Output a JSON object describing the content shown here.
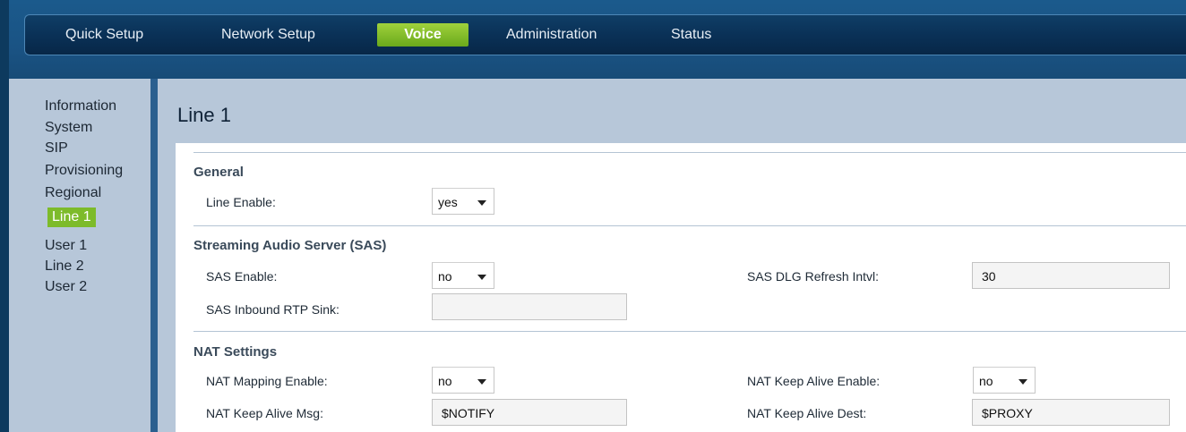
{
  "nav": {
    "items": [
      {
        "label": "Quick Setup"
      },
      {
        "label": "Network Setup"
      },
      {
        "label": "Voice",
        "active": true
      },
      {
        "label": "Administration"
      },
      {
        "label": "Status"
      }
    ],
    "active_color": "#7cb92a"
  },
  "sidebar": {
    "items": [
      {
        "label": "Information"
      },
      {
        "label": "System"
      },
      {
        "label": "SIP"
      },
      {
        "label": "Provisioning"
      },
      {
        "label": "Regional"
      },
      {
        "label": "Line 1",
        "active": true
      },
      {
        "label": "User 1"
      },
      {
        "label": "Line 2"
      },
      {
        "label": "User 2"
      }
    ]
  },
  "page": {
    "title": "Line 1"
  },
  "sections": {
    "general": {
      "title": "General",
      "line_enable_label": "Line Enable:",
      "line_enable_value": "yes"
    },
    "sas": {
      "title": "Streaming Audio Server (SAS)",
      "sas_enable_label": "SAS Enable:",
      "sas_enable_value": "no",
      "sas_dlg_refresh_label": "SAS DLG Refresh Intvl:",
      "sas_dlg_refresh_value": "30",
      "sas_inbound_rtp_label": "SAS Inbound RTP Sink:",
      "sas_inbound_rtp_value": ""
    },
    "nat": {
      "title": "NAT Settings",
      "nat_mapping_label": "NAT Mapping Enable:",
      "nat_mapping_value": "no",
      "nat_keepalive_enable_label": "NAT Keep Alive Enable:",
      "nat_keepalive_enable_value": "no",
      "nat_keepalive_msg_label": "NAT Keep Alive Msg:",
      "nat_keepalive_msg_value": "$NOTIFY",
      "nat_keepalive_dest_label": "NAT Keep Alive Dest:",
      "nat_keepalive_dest_value": "$PROXY"
    }
  }
}
